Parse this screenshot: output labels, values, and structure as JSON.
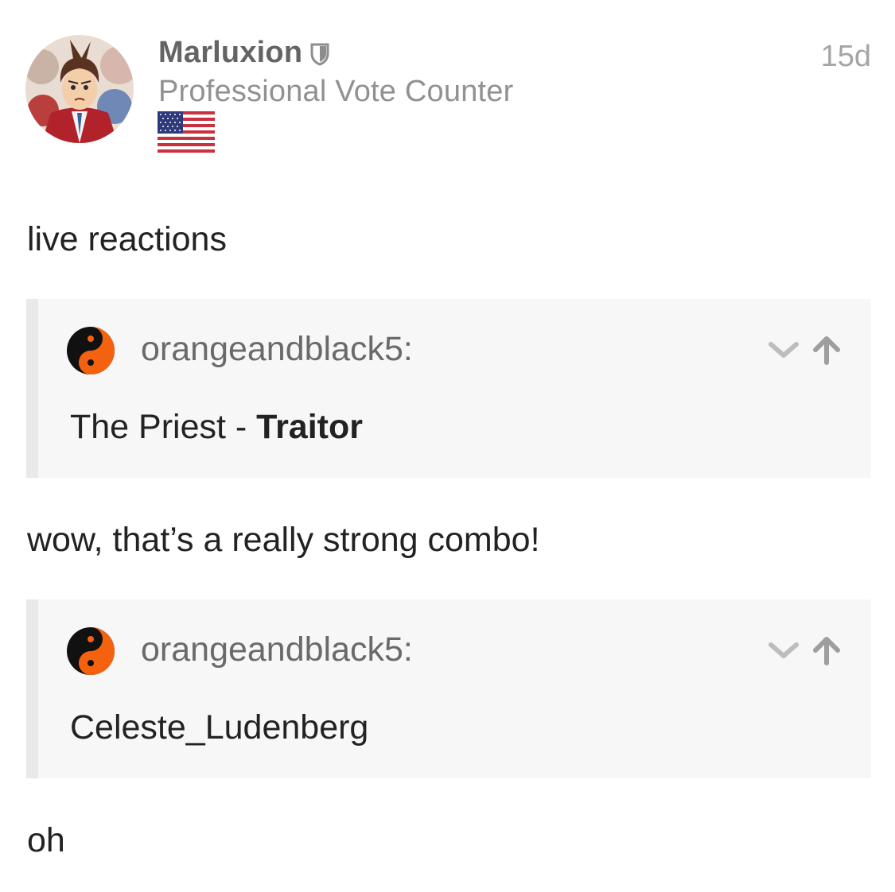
{
  "post": {
    "author": {
      "username": "Marluxion",
      "title": "Professional Vote Counter",
      "moderator_icon": "shield-icon",
      "flag": "us-flag-icon"
    },
    "age": "15d"
  },
  "content": {
    "p1": "live reactions",
    "quote1": {
      "author": "orangeandblack5:",
      "body_text": "The Priest - ",
      "body_bold": "Traitor"
    },
    "p2": "wow, that’s a really strong combo!",
    "quote2": {
      "author": "orangeandblack5:",
      "body_text": "Celeste_Ludenberg"
    },
    "p3": "oh"
  },
  "colors": {
    "username": "#646464",
    "title": "#919191",
    "quote_bg": "#f7f7f7",
    "quote_border": "#e9e9e9",
    "yin_yang_orange": "#f5620f",
    "icon_gray": "#9e9e9e"
  }
}
